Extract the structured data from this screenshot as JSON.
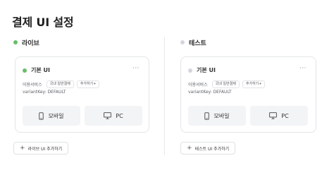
{
  "page": {
    "title": "결제 UI 설정"
  },
  "live": {
    "section_title": "라이브",
    "card": {
      "title": "기본 UI",
      "more": "···",
      "service_label": "이용서비스",
      "chips": [
        "국내 일반결제",
        "추가하기+"
      ],
      "variant": "variantKey: DEFAULT",
      "devices": [
        {
          "icon": "mobile-icon",
          "label": "모바일"
        },
        {
          "icon": "pc-monitor-icon",
          "label": "PC"
        }
      ]
    },
    "add_button": {
      "icon": "+",
      "label": "라이브 UI 추가하기"
    }
  },
  "test": {
    "section_title": "테스트",
    "card": {
      "title": "기본 UI",
      "more": "···",
      "service_label": "이용서비스",
      "chips": [
        "국내 일반결제",
        "추가하기+"
      ],
      "variant": "variantKey: DEFAULT",
      "devices": [
        {
          "icon": "mobile-icon",
          "label": "모바일"
        },
        {
          "icon": "pc-monitor-icon",
          "label": "PC"
        }
      ]
    },
    "add_button": {
      "icon": "+",
      "label": "테스트 UI 추가하기"
    }
  },
  "colors": {
    "live_dot": "#6abd6a",
    "test_dot": "#d3d6dc",
    "button_bg": "#f2f4f6"
  }
}
